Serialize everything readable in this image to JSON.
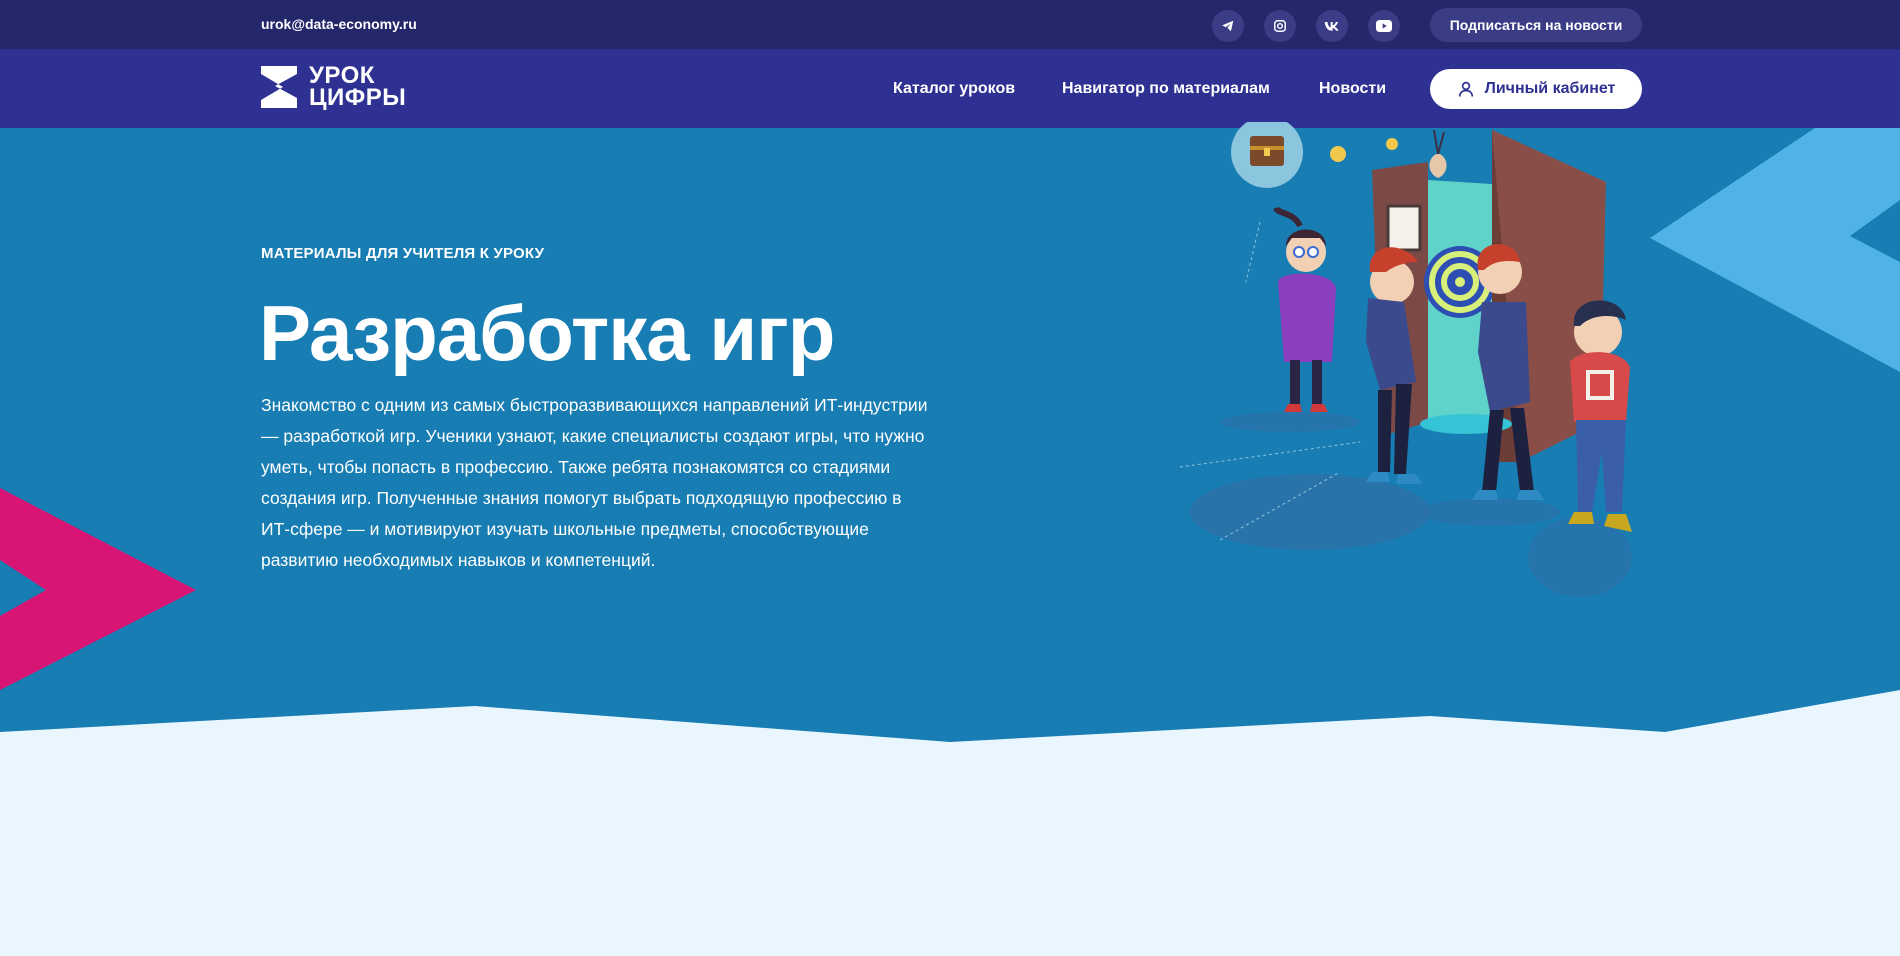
{
  "topbar": {
    "email": "urok@data-economy.ru",
    "social": [
      {
        "name": "telegram-icon",
        "glyph": "➤"
      },
      {
        "name": "instagram-icon",
        "glyph": "◎"
      },
      {
        "name": "vk-icon",
        "glyph": "vk"
      },
      {
        "name": "youtube-icon",
        "glyph": "▶"
      }
    ],
    "subscribe_label": "Подписаться на новости"
  },
  "nav": {
    "logo_line1": "УРОК",
    "logo_line2": "ЦИФРЫ",
    "links": [
      "Каталог уроков",
      "Навигатор по материалам",
      "Новости"
    ],
    "cabinet_label": "Личный кабинет"
  },
  "hero": {
    "eyebrow": "МАТЕРИАЛЫ ДЛЯ УЧИТЕЛЯ К УРОКУ",
    "title": "Разработка игр",
    "description": "Знакомство с одним из самых быстроразвивающихся направлений ИТ-индустрии — разработкой игр. Ученики узнают, какие специалисты создают игры, что нужно уметь, чтобы попасть в профессию. Также ребята познакомятся со стадиями создания игр. Полученные знания помогут выбрать подходящую профессию в ИТ-сфере — и мотивируют изучать школьные предметы, способствующие развитию необходимых навыков и компетенций."
  },
  "colors": {
    "topbar": "#25276b",
    "navbar": "#2f3192",
    "hero": "#177db3",
    "page": "#eaf6fd",
    "accent_pink": "#d81475",
    "accent_light_blue": "#4fb3e6"
  }
}
